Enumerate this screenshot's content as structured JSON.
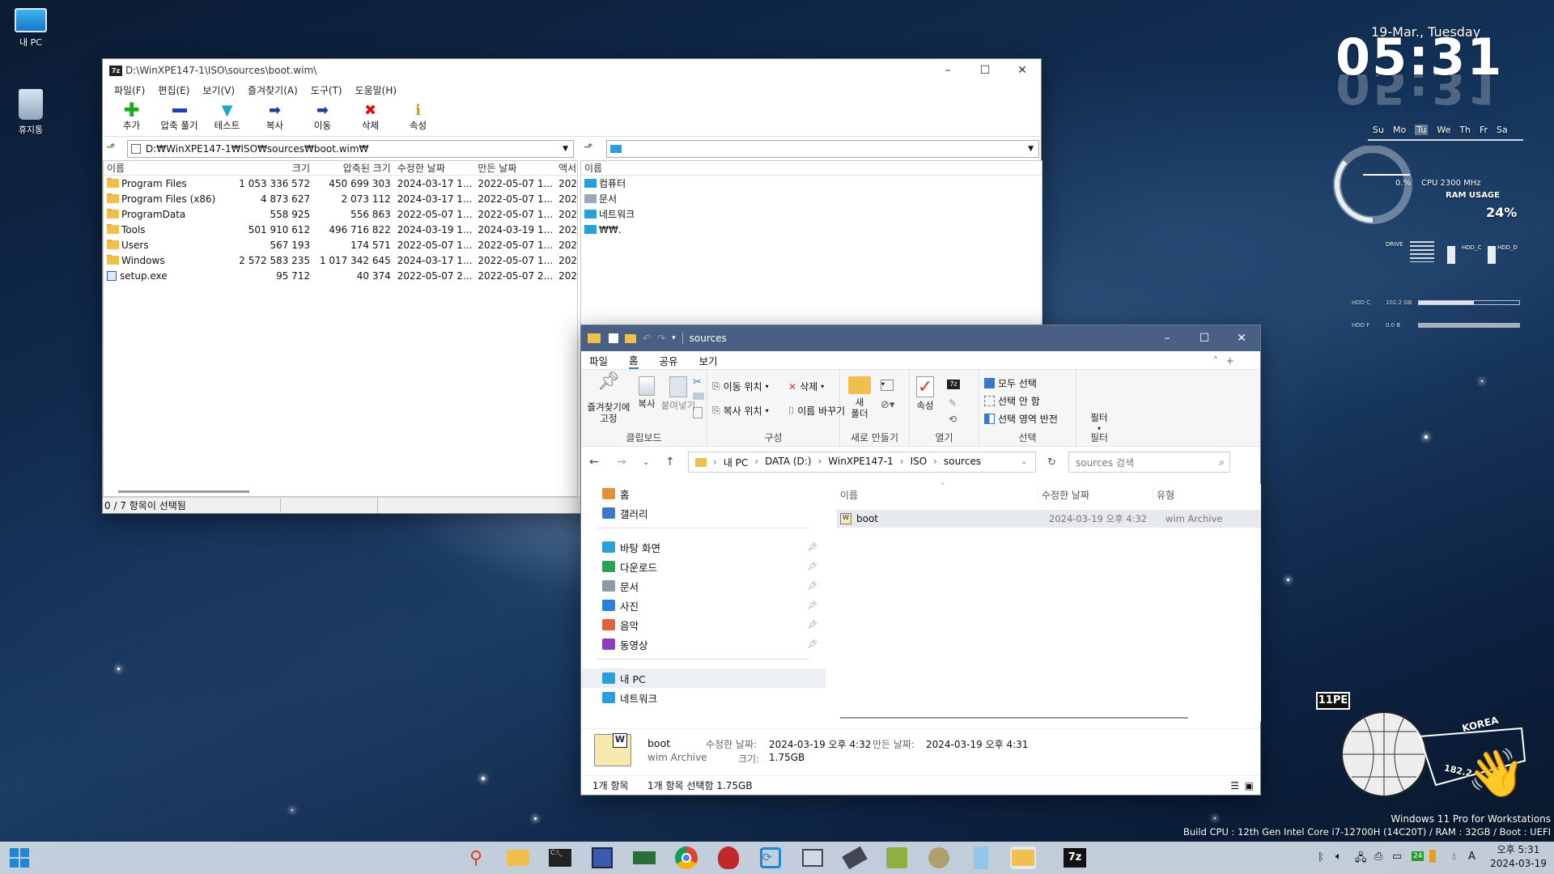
{
  "desktop": {
    "icons": [
      {
        "label": "내 PC"
      },
      {
        "label": "휴지통"
      }
    ]
  },
  "sevenzip": {
    "title": "D:\\WinXPE147-1\\ISO\\sources\\boot.wim\\",
    "menu": [
      "파일(F)",
      "편집(E)",
      "보기(V)",
      "즐겨찾기(A)",
      "도구(T)",
      "도움말(H)"
    ],
    "toolbar": [
      {
        "label": "추가",
        "icon": "plus-icon",
        "color": "#1fa71f"
      },
      {
        "label": "압축 풀기",
        "icon": "minus-icon",
        "color": "#1f3fb0"
      },
      {
        "label": "테스트",
        "icon": "check-icon",
        "color": "#1aa6c9"
      },
      {
        "label": "복사",
        "icon": "copy-arrow-icon",
        "color": "#1f3f9a"
      },
      {
        "label": "이동",
        "icon": "move-arrow-icon",
        "color": "#1f3f9a"
      },
      {
        "label": "삭제",
        "icon": "delete-x-icon",
        "color": "#d11"
      },
      {
        "label": "속성",
        "icon": "info-icon",
        "color": "#c9a400"
      }
    ],
    "left_path": "D:₩WinXPE147-1₩ISO₩sources₩boot.wim₩",
    "columns": [
      "이름",
      "크기",
      "압축된 크기",
      "수정한 날짜",
      "만든 날짜",
      "액서"
    ],
    "rows": [
      {
        "name": "Program Files",
        "size": "1 053 336 572",
        "packed": "450 699 303",
        "modified": "2024-03-17 1...",
        "created": "2022-05-07 1...",
        "acc": "202",
        "type": "folder"
      },
      {
        "name": "Program Files (x86)",
        "size": "4 873 627",
        "packed": "2 073 112",
        "modified": "2024-03-17 1...",
        "created": "2022-05-07 1...",
        "acc": "202",
        "type": "folder"
      },
      {
        "name": "ProgramData",
        "size": "558 925",
        "packed": "556 863",
        "modified": "2022-05-07 1...",
        "created": "2022-05-07 1...",
        "acc": "202",
        "type": "folder"
      },
      {
        "name": "Tools",
        "size": "501 910 612",
        "packed": "496 716 822",
        "modified": "2024-03-19 1...",
        "created": "2024-03-19 1...",
        "acc": "202",
        "type": "folder"
      },
      {
        "name": "Users",
        "size": "567 193",
        "packed": "174 571",
        "modified": "2022-05-07 1...",
        "created": "2022-05-07 1...",
        "acc": "202",
        "type": "folder"
      },
      {
        "name": "Windows",
        "size": "2 572 583 235",
        "packed": "1 017 342 645",
        "modified": "2024-03-17 1...",
        "created": "2022-05-07 1...",
        "acc": "202",
        "type": "folder"
      },
      {
        "name": "setup.exe",
        "size": "95 712",
        "packed": "40 374",
        "modified": "2022-05-07 2...",
        "created": "2022-05-07 2...",
        "acc": "202",
        "type": "exe"
      }
    ],
    "right_column": "이름",
    "right_items": [
      {
        "name": "컴퓨터",
        "color": "#2a9fd8"
      },
      {
        "name": "문서",
        "color": "#9aa8b8"
      },
      {
        "name": "네트워크",
        "color": "#2a9fd8"
      },
      {
        "name": "₩₩.",
        "color": "#2a9fd8"
      }
    ],
    "status": "0 / 7 항목이 선택됨"
  },
  "explorer": {
    "title": "sources",
    "tabs": [
      "파일",
      "홈",
      "공유",
      "보기"
    ],
    "ribbon": {
      "pin": "즐겨찾기에 고정",
      "copy": "복사",
      "paste": "붙여넣기",
      "clipboard": "클립보드",
      "moveto": "이동 위치",
      "copyto": "복사 위치",
      "delete": "삭제",
      "rename": "이름 바꾸기",
      "organize": "구성",
      "newfolder": "새 폴더",
      "new": "새로 만들기",
      "props": "속성",
      "open": "열기",
      "selectall": "모두 선택",
      "selectnone": "선택 안 함",
      "invert": "선택 영역 반전",
      "select": "선택",
      "filter": "필터",
      "filtergroup": "필터"
    },
    "breadcrumb": [
      "내 PC",
      "DATA (D:)",
      "WinXPE147-1",
      "ISO",
      "sources"
    ],
    "search_placeholder": "sources 검색",
    "nav": [
      {
        "label": "홈",
        "color": "#e0913a",
        "pinned": false
      },
      {
        "label": "갤러리",
        "color": "#3a78c8",
        "pinned": false
      },
      {
        "label": "바탕 화면",
        "color": "#2a9fd8",
        "pinned": true
      },
      {
        "label": "다운로드",
        "color": "#2aa05a",
        "pinned": true
      },
      {
        "label": "문서",
        "color": "#8a9aaa",
        "pinned": true
      },
      {
        "label": "사진",
        "color": "#2a80d8",
        "pinned": true
      },
      {
        "label": "음악",
        "color": "#e06040",
        "pinned": true
      },
      {
        "label": "동영상",
        "color": "#8a40c0",
        "pinned": true
      },
      {
        "label": "내 PC",
        "color": "#2a9fd8",
        "pinned": false
      },
      {
        "label": "네트워크",
        "color": "#2a9fd8",
        "pinned": false
      }
    ],
    "columns": [
      "이름",
      "수정한 날짜",
      "유형"
    ],
    "files": [
      {
        "name": "boot",
        "modified": "2024-03-19 오후 4:32",
        "type": "wim Archive"
      }
    ],
    "details": {
      "name": "boot",
      "type": "wim Archive",
      "modified_label": "수정한 날짜:",
      "modified": "2024-03-19 오후 4:32",
      "created_label": "만든 날짜:",
      "created": "2024-03-19 오후 4:31",
      "size_label": "크기:",
      "size": "1.75GB"
    },
    "status_count": "1개 항목",
    "status_selected": "1개 항목 선택함 1.75GB"
  },
  "widget": {
    "date": "19-Mar., Tuesday",
    "time": "05:31",
    "days": [
      "Su",
      "Mo",
      "Tu",
      "We",
      "Th",
      "Fr",
      "Sa"
    ],
    "cpu_pct": "0.%",
    "cpu_label": "CPU 2300 MHz",
    "ram_label": "RAM USAGE",
    "ram_pct": "24%",
    "ram_fraction": 0.24,
    "hdd_c": "102.2 GB",
    "hdd_c_fraction": 0.55,
    "hdd_f": "0.0 B",
    "drive_label": "DRIVE",
    "disk1": "HDD_C",
    "disk2": "HDD_D"
  },
  "badge": {
    "tag": "11PE",
    "country": "KOREA",
    "num": "182.2"
  },
  "watermark": {
    "line1": "Windows 11 Pro for Workstations",
    "line2": "Build CPU : 12th Gen Intel Core i7-12700H (14C20T) / RAM : 32GB / Boot : UEFI"
  },
  "tray": {
    "time": "오후 5:31",
    "date": "2024-03-19",
    "lang": "A",
    "battery": "24"
  }
}
